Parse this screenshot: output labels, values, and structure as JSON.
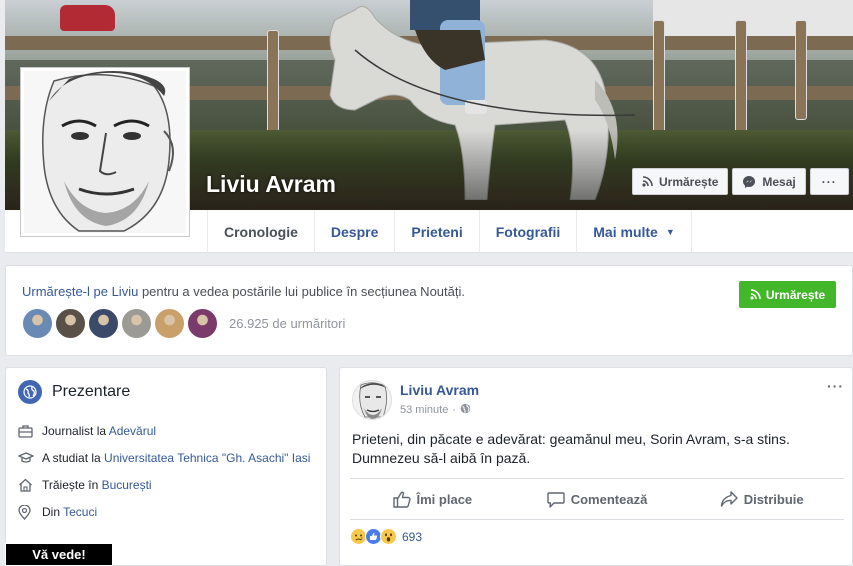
{
  "profile": {
    "name": "Liviu Avram",
    "actions": {
      "follow_label": "Urmărește",
      "message_label": "Mesaj",
      "more_label": "···"
    }
  },
  "nav": {
    "tabs": [
      {
        "label": "Cronologie"
      },
      {
        "label": "Despre"
      },
      {
        "label": "Prieteni"
      },
      {
        "label": "Fotografii"
      },
      {
        "label": "Mai multe"
      }
    ]
  },
  "follow_box": {
    "link_text": "Urmărește-l pe Liviu",
    "rest_text": " pentru a vedea postările lui publice în secțiunea Noutăți.",
    "button_label": "Urmărește",
    "follower_count": "26.925 de urmăritori",
    "follower_avatar_colors": [
      "#6a8ab5",
      "#5a5048",
      "#3c4a6a",
      "#9c9a94",
      "#c9a06a",
      "#7a3a6a"
    ]
  },
  "intro": {
    "title": "Prezentare",
    "items": [
      {
        "icon": "briefcase-icon",
        "prefix": "Journalist la ",
        "link": "Adevărul",
        "suffix": ""
      },
      {
        "icon": "graduation-cap-icon",
        "prefix": "A studiat la ",
        "link": "Universitatea Tehnica \"Gh. Asachi\" Iasi",
        "suffix": ""
      },
      {
        "icon": "home-icon",
        "prefix": "Trăiește în ",
        "link": "București",
        "suffix": ""
      },
      {
        "icon": "location-pin-icon",
        "prefix": "Din ",
        "link": "Tecuci",
        "suffix": ""
      }
    ]
  },
  "banner": {
    "text": "Vă vede!"
  },
  "post": {
    "author": "Liviu Avram",
    "time": "53 minute",
    "text_line1": "Prieteni, din păcate e adevărat: geamănul meu, Sorin Avram, s-a stins.",
    "text_line2": "Dumnezeu să-l aibă în pază.",
    "menu": "···",
    "actions": {
      "like_label": "Îmi place",
      "comment_label": "Comentează",
      "share_label": "Distribuie"
    },
    "reaction_icons": [
      "sad-reaction-icon",
      "like-reaction-icon",
      "wow-reaction-icon"
    ],
    "reaction_count": "693"
  },
  "colors": {
    "link_blue": "#365899",
    "follow_green": "#42b72a",
    "facebook_blue": "#4267b2",
    "page_bg": "#e9ebee"
  }
}
